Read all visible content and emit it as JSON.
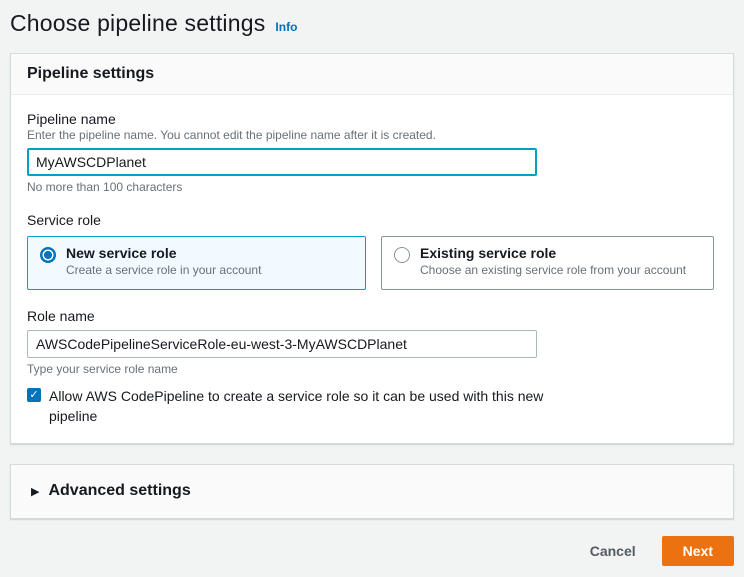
{
  "page": {
    "title": "Choose pipeline settings",
    "info_label": "Info"
  },
  "panel": {
    "header": "Pipeline settings"
  },
  "pipeline_name": {
    "label": "Pipeline name",
    "description": "Enter the pipeline name. You cannot edit the pipeline name after it is created.",
    "value": "MyAWSCDPlanet",
    "hint": "No more than 100 characters"
  },
  "service_role": {
    "label": "Service role",
    "options": [
      {
        "title": "New service role",
        "description": "Create a service role in your account",
        "selected": true
      },
      {
        "title": "Existing service role",
        "description": "Choose an existing service role from your account",
        "selected": false
      }
    ]
  },
  "role_name": {
    "label": "Role name",
    "value": "AWSCodePipelineServiceRole-eu-west-3-MyAWSCDPlanet",
    "hint": "Type your service role name"
  },
  "allow_checkbox": {
    "label": "Allow AWS CodePipeline to create a service role so it can be used with this new pipeline",
    "checked": true,
    "check_glyph": "✓"
  },
  "advanced": {
    "label": "Advanced settings",
    "caret_glyph": "▶"
  },
  "footer": {
    "cancel_label": "Cancel",
    "next_label": "Next"
  },
  "colors": {
    "primary_button": "#ec7211",
    "link_blue": "#0073bb",
    "focus_blue": "#00a1c9",
    "selected_tile_bg": "#f1faff",
    "page_bg": "#f2f3f3"
  }
}
